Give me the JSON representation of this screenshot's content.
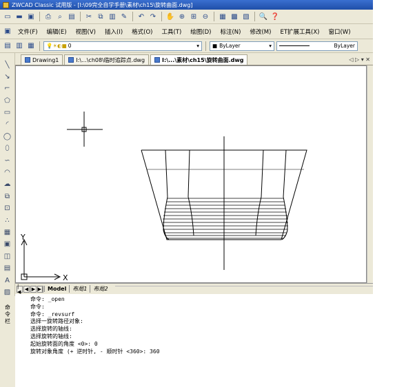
{
  "title": "ZWCAD Classic 试用版 - [I:\\09完全自学手册\\素材\\ch15\\旋转曲面.dwg]",
  "menu": [
    "文件(F)",
    "编辑(E)",
    "视图(V)",
    "插入(I)",
    "格式(O)",
    "工具(T)",
    "绘图(D)",
    "标注(N)",
    "修改(M)",
    "ET扩展工具(X)",
    "窗口(W)"
  ],
  "layer_combo": "0",
  "color_combo": "ByLayer",
  "linetype_combo": "ByLayer",
  "doc_tabs": [
    {
      "label": "Drawing1"
    },
    {
      "label": "I:\\...\\ch08\\临时追踪点.dwg"
    },
    {
      "label": "I:\\...\\素材\\ch15\\旋转曲面.dwg"
    }
  ],
  "tab_controls": "◁ ▷ ▾ ✕",
  "layout_tabs": [
    "Model",
    "布局1",
    "布局2"
  ],
  "axis": {
    "x": "X",
    "y": "Y"
  },
  "cmd_handle": [
    "命",
    "令",
    "栏"
  ],
  "command_lines": [
    "命令: _open",
    "命令:",
    "命令: _revsurf",
    "选择一旋转路径对象:",
    "选择旋转的轴线:",
    "选择旋转的轴线:",
    "起始旋转面的角度 <0>: 0",
    "旋转对象角度 (+ 逆时针, - 顺时针 <360>: 360"
  ],
  "colors": {
    "titlebar": "#2a5cbf",
    "panel": "#ece9d8",
    "canvas": "#ffffff"
  }
}
